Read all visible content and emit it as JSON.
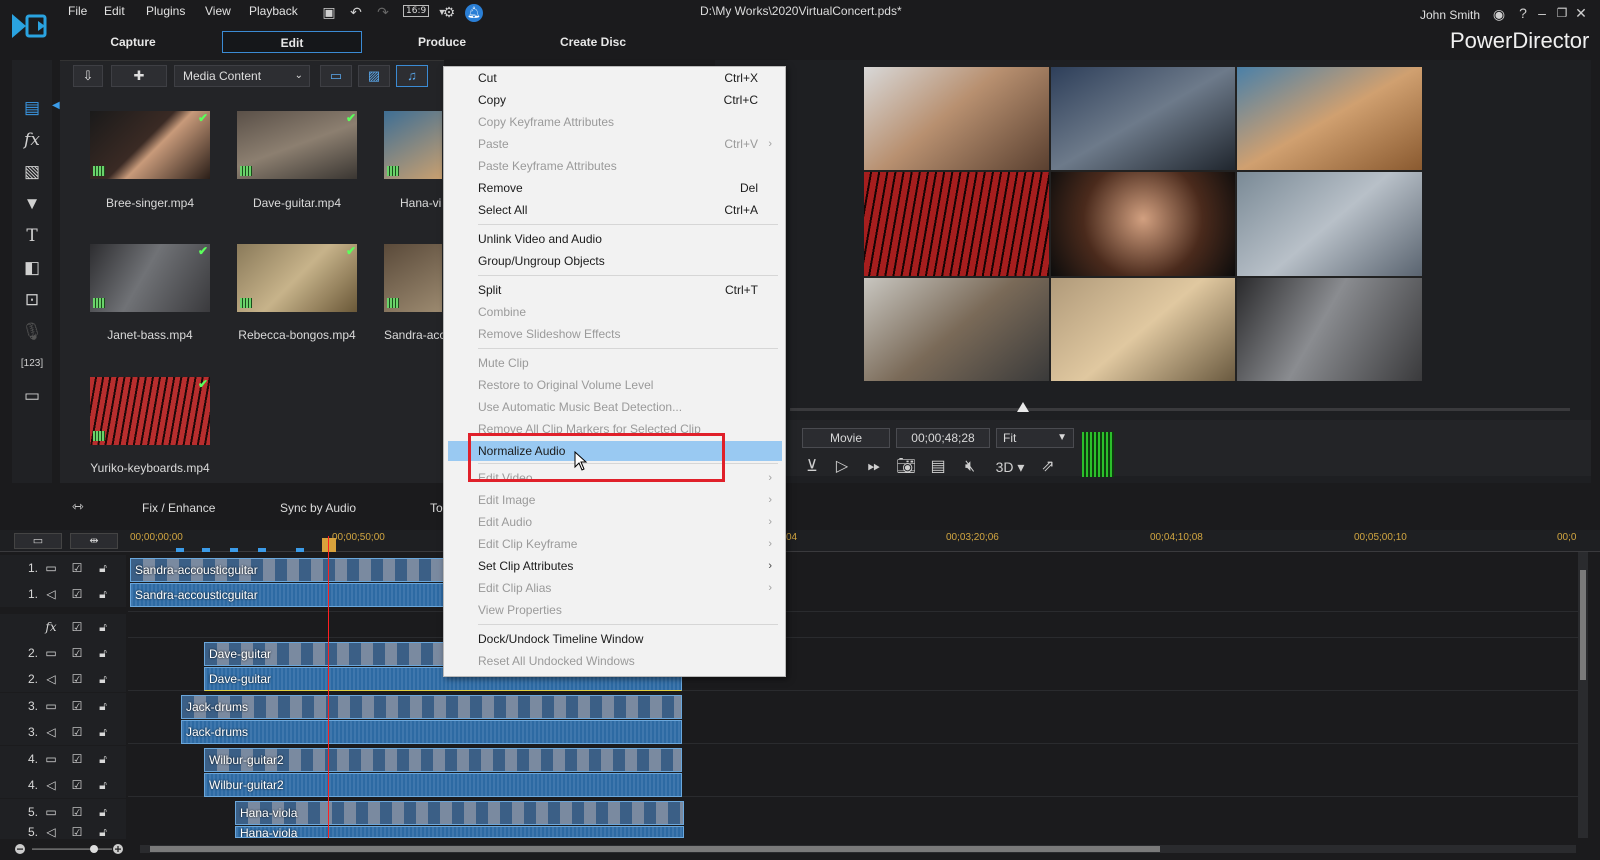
{
  "menu": [
    "File",
    "Edit",
    "Plugins",
    "View",
    "Playback"
  ],
  "aspect": "16:9",
  "doc_title": "D:\\My Works\\2020VirtualConcert.pds*",
  "user": "John Smith",
  "app_name": "PowerDirector",
  "mode_tabs": [
    "Capture",
    "Edit",
    "Produce",
    "Create Disc"
  ],
  "library": {
    "dropdown": "Media Content",
    "items": [
      {
        "label": "Bree-singer.mp4"
      },
      {
        "label": "Dave-guitar.mp4"
      },
      {
        "label": "Hana-vi"
      },
      {
        "label": "Janet-bass.mp4"
      },
      {
        "label": "Rebecca-bongos.mp4"
      },
      {
        "label": "Sandra-acc"
      },
      {
        "label": "Yuriko-keyboards.mp4"
      }
    ]
  },
  "preview": {
    "mode": "Movie",
    "timecode": "00;00;48;28",
    "fit": "Fit",
    "three_d": "3D"
  },
  "edit_toolbar": [
    "Fix / Enhance",
    "Sync by Audio",
    "To"
  ],
  "ruler": [
    "00;00;00;00",
    "00;00;50;00",
    "04",
    "00;03;20;06",
    "00;04;10;08",
    "00;05;00;10",
    "00;0"
  ],
  "tracks": [
    {
      "num": "1."
    },
    {
      "num": "1."
    },
    {
      "num": ""
    },
    {
      "num": "2."
    },
    {
      "num": "2."
    },
    {
      "num": "3."
    },
    {
      "num": "3."
    },
    {
      "num": "4."
    },
    {
      "num": "4."
    },
    {
      "num": "5."
    },
    {
      "num": "5."
    }
  ],
  "clips": {
    "c1v": "Sandra-accousticguitar",
    "c1a": "Sandra-accousticguitar",
    "c2v": "Dave-guitar",
    "c2a": "Dave-guitar",
    "c3v": "Jack-drums",
    "c3a": "Jack-drums",
    "c4v": "Wilbur-guitar2",
    "c4a": "Wilbur-guitar2",
    "c5v": "Hana-viola",
    "c5a": "Hana-viola"
  },
  "context_menu": [
    {
      "label": "Cut",
      "shortcut": "Ctrl+X",
      "enabled": true
    },
    {
      "label": "Copy",
      "shortcut": "Ctrl+C",
      "enabled": true
    },
    {
      "label": "Copy Keyframe Attributes",
      "shortcut": "",
      "enabled": false
    },
    {
      "label": "Paste",
      "shortcut": "Ctrl+V",
      "enabled": false
    },
    {
      "label": "Paste Keyframe Attributes",
      "shortcut": "",
      "enabled": false
    },
    {
      "label": "Remove",
      "shortcut": "Del",
      "enabled": true
    },
    {
      "label": "Select All",
      "shortcut": "Ctrl+A",
      "enabled": true
    },
    {
      "label": "Unlink Video and Audio",
      "shortcut": "",
      "enabled": true
    },
    {
      "label": "Group/Ungroup Objects",
      "shortcut": "",
      "enabled": true
    },
    {
      "label": "Split",
      "shortcut": "Ctrl+T",
      "enabled": true
    },
    {
      "label": "Combine",
      "shortcut": "",
      "enabled": false
    },
    {
      "label": "Remove Slideshow Effects",
      "shortcut": "",
      "enabled": false
    },
    {
      "label": "Mute Clip",
      "shortcut": "",
      "enabled": false
    },
    {
      "label": "Restore to Original Volume Level",
      "shortcut": "",
      "enabled": false
    },
    {
      "label": "Use Automatic Music Beat Detection...",
      "shortcut": "",
      "enabled": false
    },
    {
      "label": "Remove All Clip Markers for Selected Clip",
      "shortcut": "",
      "enabled": false
    },
    {
      "label": "Normalize Audio",
      "shortcut": "",
      "enabled": true,
      "highlighted": true
    },
    {
      "label": "Edit Video",
      "shortcut": "",
      "enabled": false,
      "submenu": true
    },
    {
      "label": "Edit Image",
      "shortcut": "",
      "enabled": false,
      "submenu": true
    },
    {
      "label": "Edit Audio",
      "shortcut": "",
      "enabled": false,
      "submenu": true
    },
    {
      "label": "Edit Clip Keyframe",
      "shortcut": "",
      "enabled": false,
      "submenu": true
    },
    {
      "label": "Set Clip Attributes",
      "shortcut": "",
      "enabled": true,
      "submenu": true
    },
    {
      "label": "Edit Clip Alias",
      "shortcut": "",
      "enabled": false,
      "submenu": true
    },
    {
      "label": "View Properties",
      "shortcut": "",
      "enabled": false
    },
    {
      "label": "Dock/Undock Timeline Window",
      "shortcut": "",
      "enabled": true
    },
    {
      "label": "Reset All Undocked Windows",
      "shortcut": "",
      "enabled": false
    }
  ],
  "colors": {
    "accent": "#3b8bd4",
    "menu_highlight": "#99c9f2",
    "callout_red": "#e0202a",
    "check_green": "#5bff5b",
    "playhead": "#ff2020",
    "timecode_gold": "#d2a641"
  }
}
